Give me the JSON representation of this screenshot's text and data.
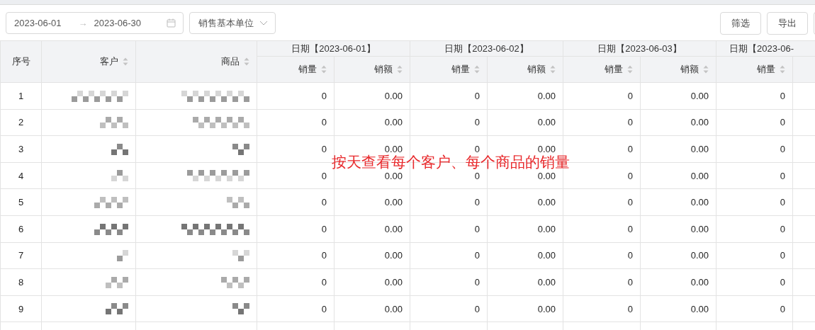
{
  "toolbar": {
    "date_range": {
      "start": "2023-06-01",
      "separator": "→",
      "end": "2023-06-30"
    },
    "unit_select": {
      "value": "销售基本单位"
    },
    "buttons": [
      "筛选",
      "导出"
    ]
  },
  "table": {
    "fixed_columns": [
      {
        "label": "序号",
        "sortable": false
      },
      {
        "label": "客户",
        "sortable": true
      },
      {
        "label": "商品",
        "sortable": true
      }
    ],
    "groups": [
      {
        "label": "日期【2023-06-01】",
        "columns": [
          {
            "label": "销量",
            "sortable": true
          },
          {
            "label": "销额",
            "sortable": true
          }
        ]
      },
      {
        "label": "日期【2023-06-02】",
        "columns": [
          {
            "label": "销量",
            "sortable": true
          },
          {
            "label": "销额",
            "sortable": true
          }
        ]
      },
      {
        "label": "日期【2023-06-03】",
        "columns": [
          {
            "label": "销量",
            "sortable": true
          },
          {
            "label": "销额",
            "sortable": true
          }
        ]
      },
      {
        "label": "日期【2023-06-",
        "columns": [
          {
            "label": "销量",
            "sortable": true
          }
        ]
      }
    ],
    "rows": [
      {
        "index": "1",
        "values": [
          "0",
          "0.00",
          "0",
          "0.00",
          "0",
          "0.00",
          "0"
        ]
      },
      {
        "index": "2",
        "values": [
          "0",
          "0.00",
          "0",
          "0.00",
          "0",
          "0.00",
          "0"
        ]
      },
      {
        "index": "3",
        "values": [
          "0",
          "0.00",
          "0",
          "0.00",
          "0",
          "0.00",
          "0"
        ]
      },
      {
        "index": "4",
        "values": [
          "0",
          "0.00",
          "0",
          "0.00",
          "0",
          "0.00",
          "0"
        ]
      },
      {
        "index": "5",
        "values": [
          "0",
          "0.00",
          "0",
          "0.00",
          "0",
          "0.00",
          "0"
        ]
      },
      {
        "index": "6",
        "values": [
          "0",
          "0.00",
          "0",
          "0.00",
          "0",
          "0.00",
          "0"
        ]
      },
      {
        "index": "7",
        "values": [
          "0",
          "0.00",
          "0",
          "0.00",
          "0",
          "0.00",
          "0"
        ]
      },
      {
        "index": "8",
        "values": [
          "0",
          "0.00",
          "0",
          "0.00",
          "0",
          "0.00",
          "0"
        ]
      },
      {
        "index": "9",
        "values": [
          "0",
          "0.00",
          "0",
          "0.00",
          "0",
          "0.00",
          "0"
        ]
      }
    ]
  },
  "annotation": "按天查看每个客户、每个商品的销量"
}
